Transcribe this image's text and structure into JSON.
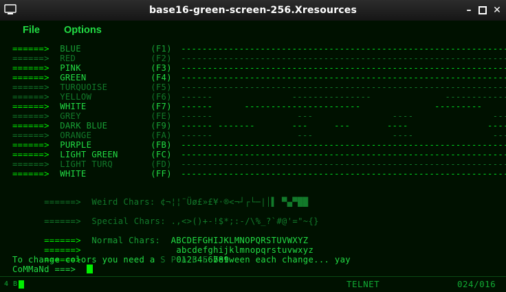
{
  "window": {
    "title": "base16-green-screen-256.Xresources"
  },
  "menubar": {
    "file_label": "File",
    "options_label": "Options"
  },
  "color_rows": [
    {
      "arrow": "======>",
      "name": "BLUE",
      "code": "(F1)",
      "dashes": "-------------------------------------------------------------------------",
      "style": "mid"
    },
    {
      "arrow": "======>",
      "name": "RED",
      "code": "(F2)",
      "dashes": "-------------------------------------------------------------------------",
      "style": "dim"
    },
    {
      "arrow": "======>",
      "name": "PINK",
      "code": "(F3)",
      "dashes": "-------------------------------------------------------------------------",
      "style": "bright"
    },
    {
      "arrow": "======>",
      "name": "GREEN",
      "code": "(F4)",
      "dashes": "-------------------------------------------------------------------------",
      "style": "bright"
    },
    {
      "arrow": "======>",
      "name": "TURQUOISE",
      "code": "(F5)",
      "dashes": "-------------------------------------------------------------------------",
      "style": "dim"
    },
    {
      "arrow": "======>",
      "name": "YELLOW",
      "code": "(F6)",
      "dashes": "------               ---------------              ------------           ---",
      "style": "dim"
    },
    {
      "arrow": "======>",
      "name": "WHITE",
      "code": "(F7)",
      "dashes": "------      ----------------------              ---------      ------------",
      "style": "bright"
    },
    {
      "arrow": "======>",
      "name": "GREY",
      "code": "(FE)",
      "dashes": "------                ---               ----               ---------------",
      "style": "dim"
    },
    {
      "arrow": "======>",
      "name": "DARK BLUE",
      "code": "(F9)",
      "dashes": "------ -------       ---     ---       ----               ---------------",
      "style": "mid"
    },
    {
      "arrow": "======>",
      "name": "ORANGE",
      "code": "(FA)",
      "dashes": "------                ---               ----               ---------------",
      "style": "dim"
    },
    {
      "arrow": "======>",
      "name": "PURPLE",
      "code": "(FB)",
      "dashes": "-------------------------------------------------------------------------",
      "style": "bright"
    },
    {
      "arrow": "======>",
      "name": "LIGHT GREEN",
      "code": "(FC)",
      "dashes": "-------------------------------------------------------------------------",
      "style": "bright"
    },
    {
      "arrow": "======>",
      "name": "LIGHT TURQ",
      "code": "(FD)",
      "dashes": "-------------------------------------------------------------------------",
      "style": "dim"
    },
    {
      "arrow": "======>",
      "name": "WHITE",
      "code": "(FF)",
      "dashes": "-------------------------------------------------------------------------",
      "style": "bright"
    }
  ],
  "weird_chars": {
    "arrow": "======>",
    "label": "Weird Chars:",
    "chars": "¢¬¦¦¨Üø£»£¥·®<¬┘┌└─|│▌ ▀▄▀██"
  },
  "special_chars": {
    "arrow": "======>",
    "label": "Special Chars:",
    "chars": ".,<>()+-!$*;:-/\\%_?`#@'=\"~{}"
  },
  "normal_chars": {
    "arrow": "======>",
    "label": "Normal Chars:",
    "upper": "ABCDEFGHIJKLMNOPQRSTUVWXYZ",
    "lower": "abcdefghijklmnopqrstuvwxyz",
    "digits": "0123456789"
  },
  "instruction": {
    "prefix": "To change colors you need a ",
    "space": "S P A C E",
    "suffix": " between each change... yay"
  },
  "command": {
    "prompt": "CoMMaNd ===>"
  },
  "status": {
    "left": "4 B",
    "session": "TELNET",
    "position": "024/016"
  },
  "colors": {
    "bright": "#22dd44",
    "dim": "#127a2a",
    "mid": "#18a035",
    "background": "#001100"
  }
}
